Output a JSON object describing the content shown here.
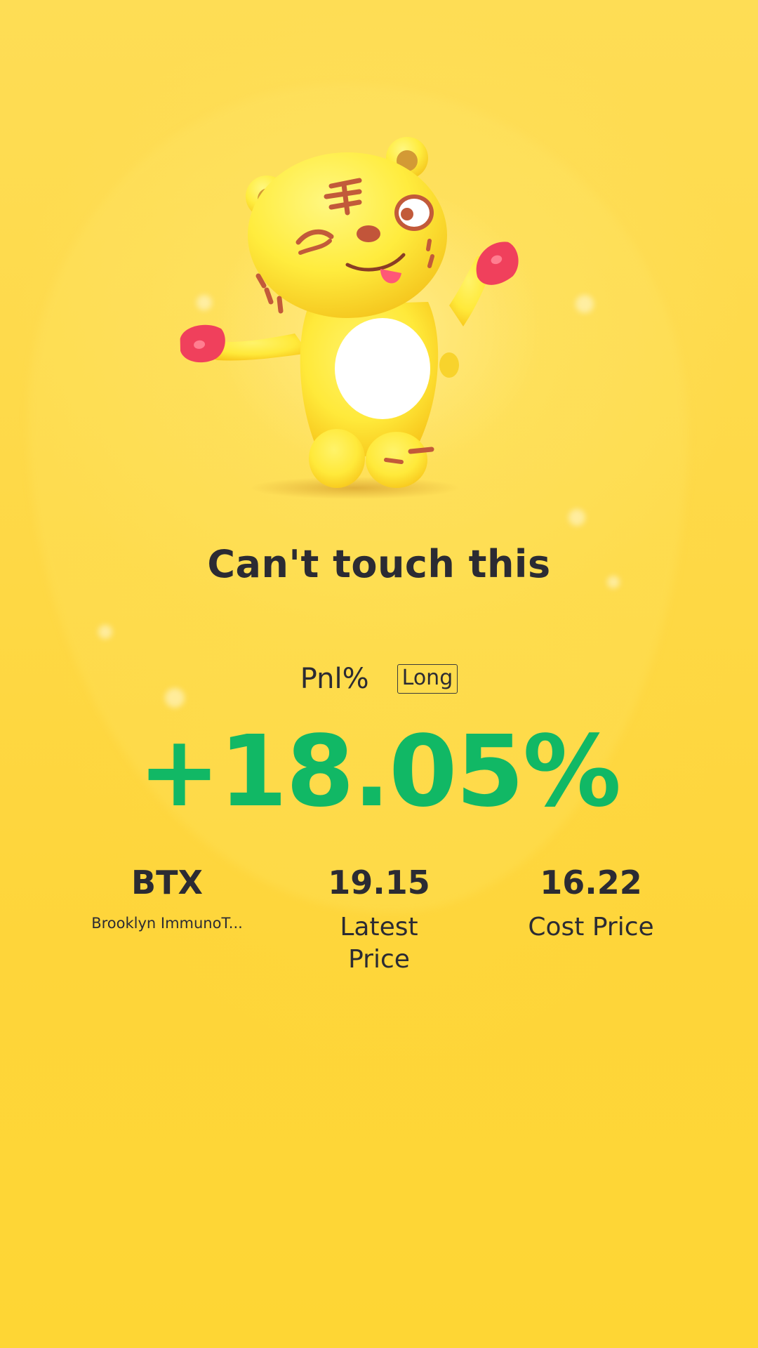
{
  "share_card": {
    "title": "Can't touch this",
    "pnl_label": "Pnl%",
    "direction": "Long",
    "pnl_value": "+18.05%",
    "colors": {
      "background": "#fed637",
      "profit": "#11b865",
      "text": "#2b2b33"
    },
    "mascot": "tiger-mascot-winking",
    "stats": [
      {
        "value": "BTX",
        "label": "Brooklyn ImmunoT..."
      },
      {
        "value": "19.15",
        "label": "Latest Price"
      },
      {
        "value": "16.22",
        "label": "Cost Price"
      }
    ]
  }
}
